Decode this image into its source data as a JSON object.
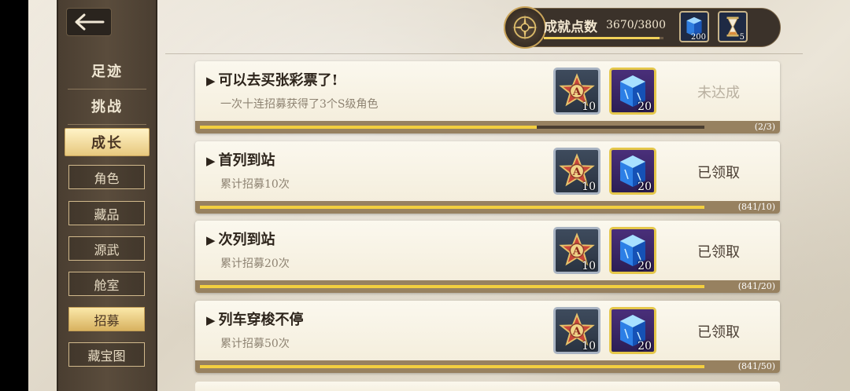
{
  "header": {
    "achievement_label": "成就点数",
    "achievement_value": "3670/3800",
    "achievement_fraction": 0.966,
    "resources": [
      {
        "icon": "blue-crystal-icon",
        "count": "200"
      },
      {
        "icon": "hourglass-icon",
        "count": "5"
      }
    ]
  },
  "sidebar": {
    "main_items": [
      {
        "label": "足迹"
      },
      {
        "label": "挑战"
      },
      {
        "label": "成长",
        "active": true
      }
    ],
    "sub_items": [
      {
        "label": "角色"
      },
      {
        "label": "藏品"
      },
      {
        "label": "源武"
      },
      {
        "label": "舱室"
      },
      {
        "label": "招募",
        "active": true
      },
      {
        "label": "藏宝图"
      }
    ]
  },
  "achievements": [
    {
      "title": "可以去买张彩票了!",
      "desc": "一次十连招募获得了3个S级角色",
      "rewards": [
        {
          "icon": "a-star-medal-icon",
          "count": "10"
        },
        {
          "icon": "blue-crystal-icon",
          "count": "20"
        }
      ],
      "status": "未达成",
      "progress_text": "(2/3)",
      "progress": 0.667
    },
    {
      "title": "首列到站",
      "desc": "累计招募10次",
      "rewards": [
        {
          "icon": "a-star-medal-icon",
          "count": "10"
        },
        {
          "icon": "blue-crystal-icon",
          "count": "20"
        }
      ],
      "status": "已领取",
      "progress_text": "(841/10)",
      "progress": 1
    },
    {
      "title": "次列到站",
      "desc": "累计招募20次",
      "rewards": [
        {
          "icon": "a-star-medal-icon",
          "count": "10"
        },
        {
          "icon": "blue-crystal-icon",
          "count": "20"
        }
      ],
      "status": "已领取",
      "progress_text": "(841/20)",
      "progress": 1
    },
    {
      "title": "列车穿梭不停",
      "desc": "累计招募50次",
      "rewards": [
        {
          "icon": "a-star-medal-icon",
          "count": "10"
        },
        {
          "icon": "blue-crystal-icon",
          "count": "20"
        }
      ],
      "status": "已领取",
      "progress_text": "(841/50)",
      "progress": 1
    }
  ],
  "colors": {
    "sidebar": "#4a3e31",
    "highlight": "#e7c87e",
    "progress_fill": "#f3cf3f",
    "progress_track": "#978160"
  }
}
